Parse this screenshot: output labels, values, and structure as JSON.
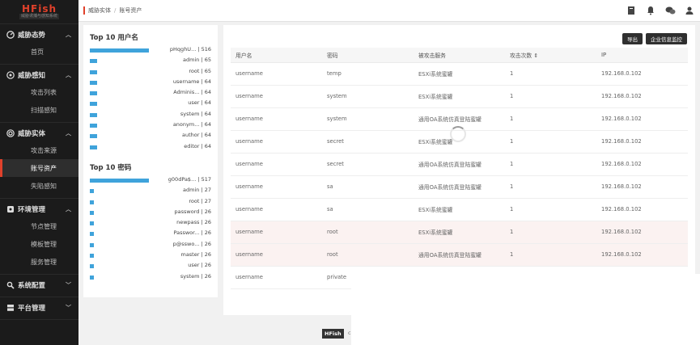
{
  "app": {
    "logo_title": "HFish",
    "logo_subtitle": "威胁诱捕与感知系统"
  },
  "sidebar": {
    "groups": [
      {
        "title": "威胁态势",
        "icon": "gauge-icon",
        "items": [
          {
            "label": "首页"
          }
        ]
      },
      {
        "title": "威胁感知",
        "icon": "radar-icon",
        "items": [
          {
            "label": "攻击列表"
          },
          {
            "label": "扫描感知"
          }
        ]
      },
      {
        "title": "威胁实体",
        "icon": "target-icon",
        "items": [
          {
            "label": "攻击来源"
          },
          {
            "label": "账号资产",
            "active": true
          },
          {
            "label": "失陷感知"
          }
        ]
      },
      {
        "title": "环境管理",
        "icon": "settings-icon",
        "items": [
          {
            "label": "节点管理"
          },
          {
            "label": "模板管理"
          },
          {
            "label": "服务管理"
          }
        ]
      },
      {
        "title": "系统配置",
        "icon": "wrench-icon",
        "items": []
      },
      {
        "title": "平台管理",
        "icon": "server-icon",
        "items": []
      }
    ]
  },
  "header": {
    "breadcrumb": [
      "威胁实体",
      "账号资产"
    ]
  },
  "left": {
    "usernames_title": "Top 10 用户名",
    "usernames": [
      {
        "label": "pHqghU... | 516",
        "value": 516
      },
      {
        "label": "admin | 65",
        "value": 65
      },
      {
        "label": "root | 65",
        "value": 65
      },
      {
        "label": "username | 64",
        "value": 64
      },
      {
        "label": "Adminis... | 64",
        "value": 64
      },
      {
        "label": "user | 64",
        "value": 64
      },
      {
        "label": "system | 64",
        "value": 64
      },
      {
        "label": "anonym... | 64",
        "value": 64
      },
      {
        "label": "author | 64",
        "value": 64
      },
      {
        "label": "editor | 64",
        "value": 64
      }
    ],
    "passwords_title": "Top 10 密码",
    "passwords": [
      {
        "label": "g00dPa$... | 517",
        "value": 517
      },
      {
        "label": "admin | 27",
        "value": 27
      },
      {
        "label": "root | 27",
        "value": 27
      },
      {
        "label": "password | 26",
        "value": 26
      },
      {
        "label": "newpass | 26",
        "value": 26
      },
      {
        "label": "Passwor... | 26",
        "value": 26
      },
      {
        "label": "p@sswo... | 26",
        "value": 26
      },
      {
        "label": "master | 26",
        "value": 26
      },
      {
        "label": "user | 26",
        "value": 26
      },
      {
        "label": "system | 26",
        "value": 26
      }
    ]
  },
  "toolbar": {
    "export": "导出",
    "monitor": "企业信息监控"
  },
  "table": {
    "headers": [
      "用户名",
      "密码",
      "被攻击服务",
      "攻击次数 ⇕",
      "IP"
    ],
    "rows": [
      {
        "user": "username",
        "pass": "temp",
        "service": "ESXi系统蜜罐",
        "count": "1",
        "ip": "192.168.0.102"
      },
      {
        "user": "username",
        "pass": "system",
        "service": "ESXi系统蜜罐",
        "count": "1",
        "ip": "192.168.0.102"
      },
      {
        "user": "username",
        "pass": "system",
        "service": "通用OA系统仿真登陆蜜罐",
        "count": "1",
        "ip": "192.168.0.102"
      },
      {
        "user": "username",
        "pass": "secret",
        "service": "ESXi系统蜜罐",
        "count": "1",
        "ip": "192.168.0.102"
      },
      {
        "user": "username",
        "pass": "secret",
        "service": "通用OA系统仿真登陆蜜罐",
        "count": "1",
        "ip": "192.168.0.102"
      },
      {
        "user": "username",
        "pass": "sa",
        "service": "通用OA系统仿真登陆蜜罐",
        "count": "1",
        "ip": "192.168.0.102"
      },
      {
        "user": "username",
        "pass": "sa",
        "service": "ESXi系统蜜罐",
        "count": "1",
        "ip": "192.168.0.102"
      },
      {
        "user": "username",
        "pass": "root",
        "service": "ESXi系统蜜罐",
        "count": "1",
        "ip": "192.168.0.102",
        "highlight": true
      },
      {
        "user": "username",
        "pass": "root",
        "service": "通用OA系统仿真登陆蜜罐",
        "count": "1",
        "ip": "192.168.0.102",
        "highlight": true
      },
      {
        "user": "username",
        "pass": "private",
        "service": "",
        "count": "",
        "ip": ""
      }
    ]
  },
  "footer": {
    "brand": "HFish",
    "text": "c"
  }
}
